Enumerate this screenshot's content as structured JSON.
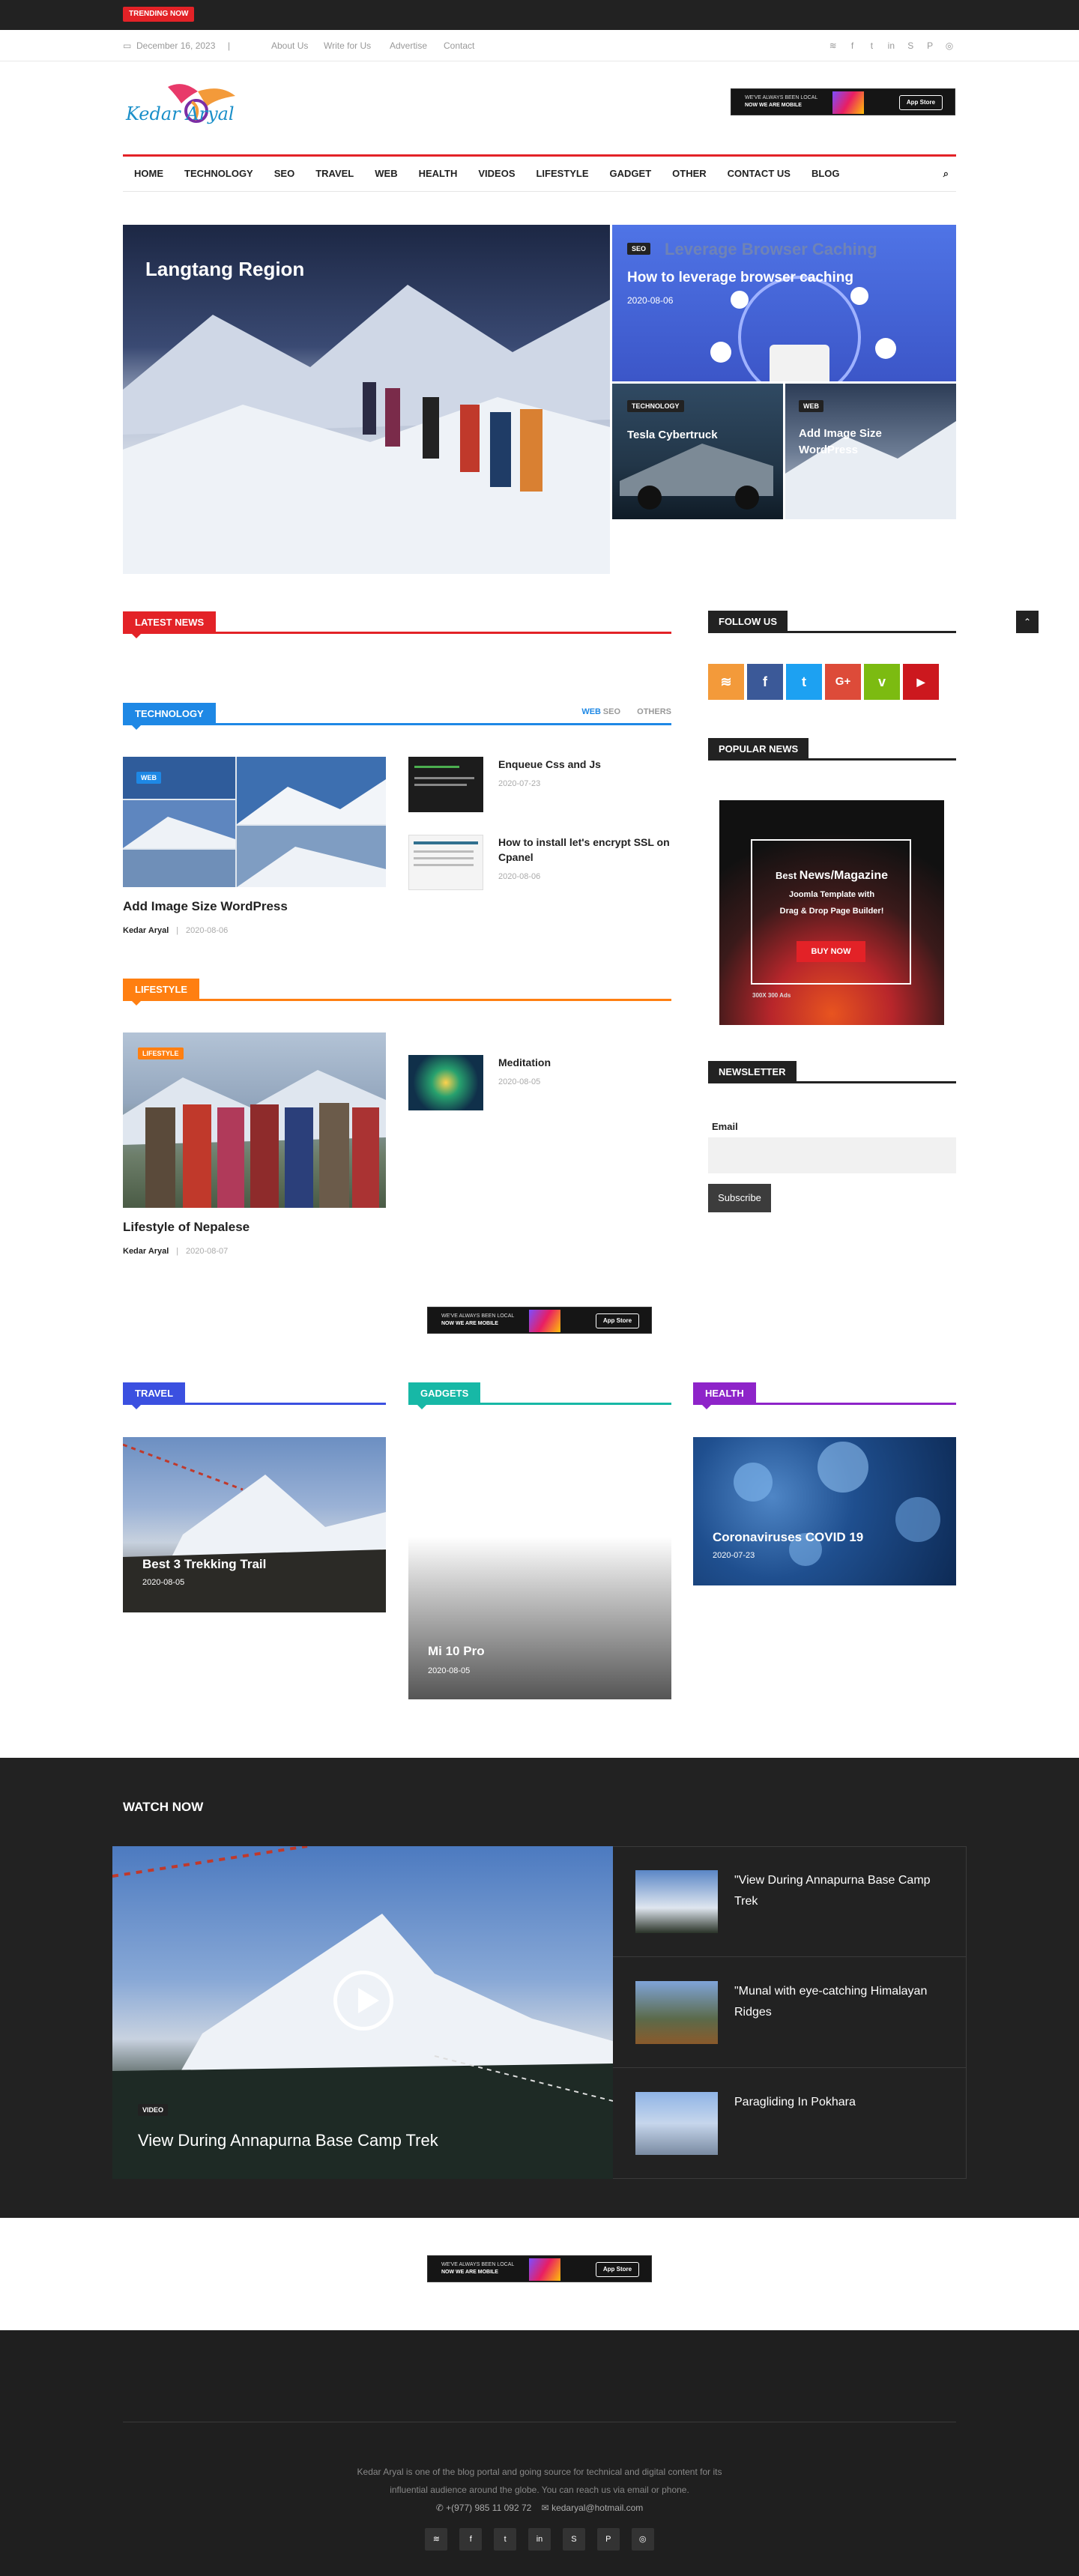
{
  "topbar": {
    "trending_label": "TRENDING NOW"
  },
  "subbar": {
    "date": "December 16, 2023",
    "links": [
      "About Us",
      "Write for Us",
      "Advertise",
      "Contact"
    ],
    "social_icons": [
      "rss-icon",
      "facebook-icon",
      "twitter-icon",
      "linkedin-icon",
      "skype-icon",
      "pinterest-icon",
      "instagram-icon"
    ]
  },
  "brand": {
    "logo_text": "Kedar Aryal",
    "accent": "#e32227"
  },
  "ad": {
    "line1": "WE'VE ALWAYS BEEN LOCAL",
    "line2": "NOW WE ARE MOBILE",
    "store": "App Store"
  },
  "nav": {
    "items": [
      "HOME",
      "TECHNOLOGY",
      "SEO",
      "TRAVEL",
      "WEB",
      "HEALTH",
      "VIDEOS",
      "LIFESTYLE",
      "GADGET",
      "OTHER",
      "CONTACT US",
      "BLOG"
    ]
  },
  "featured": {
    "main": {
      "title": "Langtang Region"
    },
    "seo": {
      "tag": "SEO",
      "banner": "Leverage Browser Caching",
      "title": "How to leverage browser caching",
      "date": "2020-08-06"
    },
    "tesla": {
      "tag": "TECHNOLOGY",
      "title": "Tesla Cybertruck"
    },
    "image_size": {
      "tag": "WEB",
      "title": "Add Image Size WordPress"
    }
  },
  "latest": {
    "heading": "LATEST NEWS",
    "color": "#e32227"
  },
  "technology": {
    "heading": "TECHNOLOGY",
    "color": "#1e88e5",
    "tabs": [
      "WEB",
      "SEO",
      "OTHERS"
    ],
    "main": {
      "tag": "WEB",
      "title": "Add Image Size WordPress",
      "author": "Kedar Aryal",
      "date": "2020-08-06"
    },
    "items": [
      {
        "title": "Enqueue Css and Js",
        "date": "2020-07-23"
      },
      {
        "title": "How to install let's encrypt SSL on Cpanel",
        "date": "2020-08-06"
      }
    ]
  },
  "lifestyle": {
    "heading": "LIFESTYLE",
    "color": "#ff7f11",
    "main": {
      "tag": "LIFESTYLE",
      "title": "Lifestyle of Nepalese",
      "author": "Kedar Aryal",
      "date": "2020-08-07"
    },
    "items": [
      {
        "title": "Meditation",
        "date": "2020-08-05"
      }
    ]
  },
  "sidebar": {
    "follow_heading": "FOLLOW US",
    "social": [
      {
        "icon": "rss-icon",
        "glyph": "≋",
        "color": "#f39a3a"
      },
      {
        "icon": "facebook-icon",
        "glyph": "f",
        "color": "#3b5998"
      },
      {
        "icon": "twitter-icon",
        "glyph": "t",
        "color": "#1da1f2"
      },
      {
        "icon": "google-plus-icon",
        "glyph": "G+",
        "color": "#dd4b39"
      },
      {
        "icon": "vine-icon",
        "glyph": "v",
        "color": "#7cbb11"
      },
      {
        "icon": "youtube-icon",
        "glyph": "▶",
        "color": "#cc181e"
      }
    ],
    "popular_heading": "POPULAR NEWS",
    "promo": {
      "line1a": "Best ",
      "line1b": "News/Magazine",
      "line2": "Joomla Template with",
      "line3": "Drag & Drop Page Builder!",
      "button": "BUY NOW",
      "footer": "300X 300 Ads"
    },
    "newsletter_heading": "NEWSLETTER",
    "email_label": "Email",
    "email_placeholder": "",
    "subscribe": "Subscribe"
  },
  "travel": {
    "heading": "TRAVEL",
    "color": "#3b50e0",
    "title": "Best 3 Trekking Trail",
    "date": "2020-08-05"
  },
  "gadgets": {
    "heading": "GADGETS",
    "color": "#17b8a6",
    "title": "Mi 10 Pro",
    "date": "2020-08-05"
  },
  "health": {
    "heading": "HEALTH",
    "color": "#8e24c9",
    "title": "Coronaviruses COVID 19",
    "date": "2020-07-23"
  },
  "watch": {
    "heading": "WATCH NOW",
    "main": {
      "tag": "VIDEO",
      "title": "View During Annapurna Base Camp Trek"
    },
    "items": [
      {
        "title": "\"View During Annapurna Base Camp Trek"
      },
      {
        "title": "\"Munal with eye-catching Himalayan Ridges"
      },
      {
        "title": "Paragliding In Pokhara"
      }
    ]
  },
  "footer": {
    "about_line1": "Kedar Aryal is one of the blog portal and going source for technical and digital content for its",
    "about_line2": "influential audience around the globe. You can reach us via email or phone.",
    "phone": "+(977) 985 11 092 72",
    "email": "kedaryal@hotmail.com",
    "social_icons": [
      "rss-icon",
      "facebook-icon",
      "twitter-icon",
      "linkedin-icon",
      "skype-icon",
      "pinterest-icon",
      "instagram-icon"
    ]
  }
}
